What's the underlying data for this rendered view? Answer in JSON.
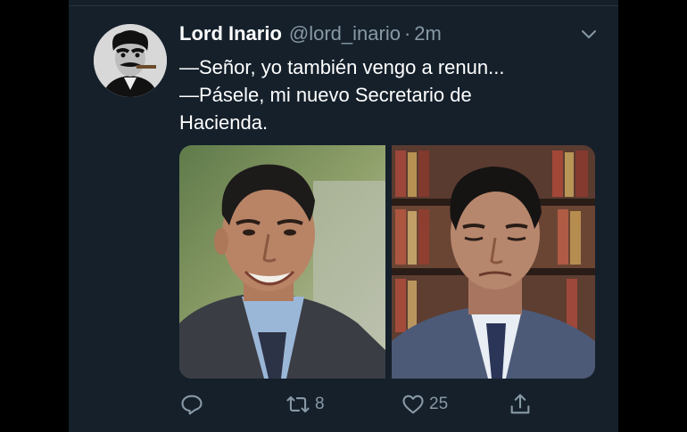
{
  "tweet": {
    "display_name": "Lord Inario",
    "handle": "@lord_inario",
    "separator": "·",
    "timestamp": "2m",
    "text_lines": [
      "—Señor, yo también vengo a renun...",
      "—Pásele, mi nuevo Secretario de",
      "Hacienda."
    ]
  },
  "actions": {
    "reply_icon": "reply-icon",
    "retweet_icon": "retweet-icon",
    "retweet_count": "8",
    "like_icon": "heart-icon",
    "like_count": "25",
    "share_icon": "share-icon"
  },
  "colors": {
    "background": "#15202b",
    "text_primary": "#ffffff",
    "text_secondary": "#8899a6"
  }
}
